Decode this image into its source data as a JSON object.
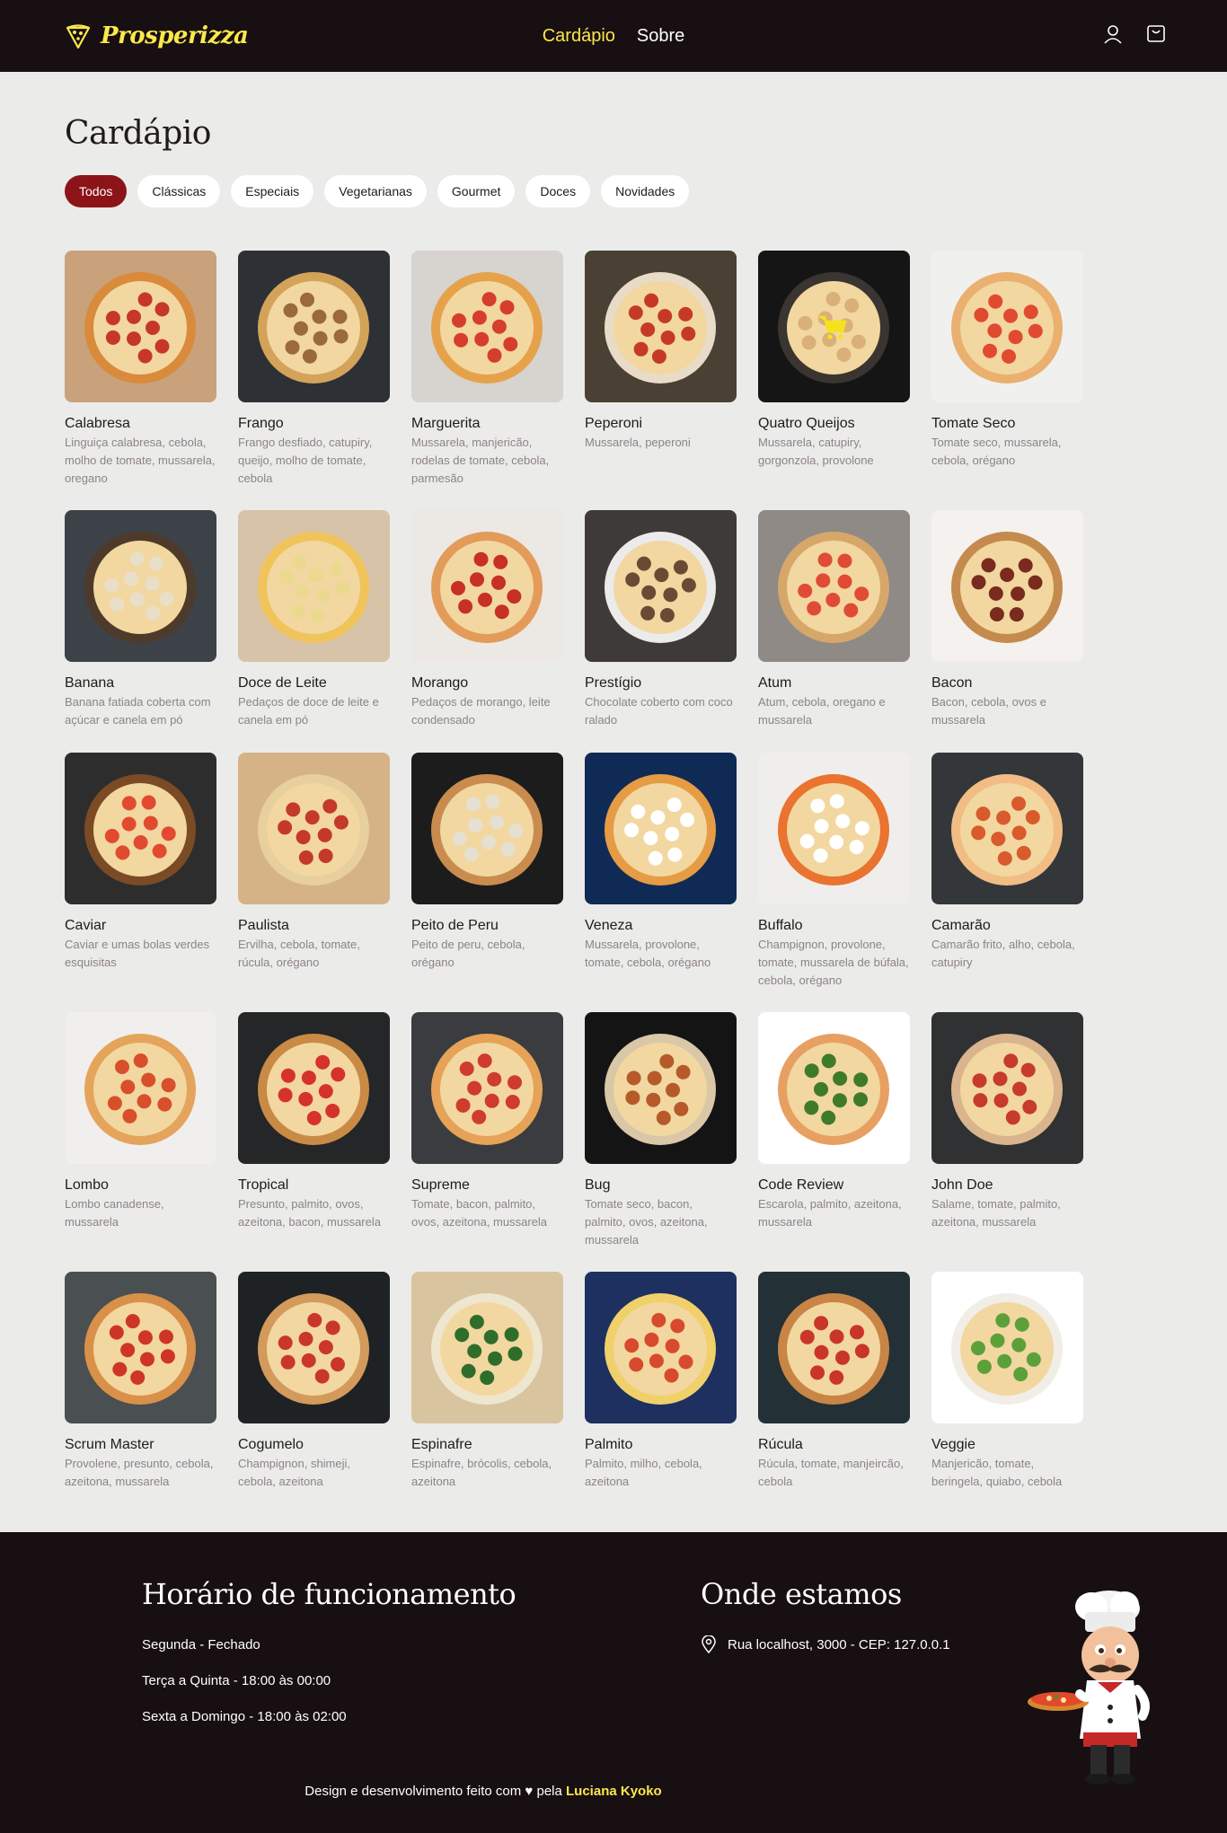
{
  "brand": {
    "name": "Prosperizza"
  },
  "nav": {
    "items": [
      {
        "label": "Cardápio"
      },
      {
        "label": "Sobre"
      }
    ]
  },
  "main": {
    "title": "Cardápio",
    "filters": [
      "Todos",
      "Clássicas",
      "Especiais",
      "Vegetarianas",
      "Gourmet",
      "Doces",
      "Novidades"
    ],
    "selected_filter": "Todos"
  },
  "pizzas": [
    {
      "name": "Calabresa",
      "desc": "Linguiça calabresa, cebola, molho de tomate, mussarela, oregano"
    },
    {
      "name": "Frango",
      "desc": "Frango desfiado, catupiry, queijo, molho de tomate, cebola"
    },
    {
      "name": "Marguerita",
      "desc": "Mussarela, manjericão, rodelas de tomate, cebola, parmesão"
    },
    {
      "name": "Peperoni",
      "desc": "Mussarela, peperoni"
    },
    {
      "name": "Quatro Queijos",
      "desc": "Mussarela, catupiry, gorgonzola, provolone"
    },
    {
      "name": "Tomate Seco",
      "desc": "Tomate seco, mussarela, cebola, orégano"
    },
    {
      "name": "Banana",
      "desc": "Banana fatiada coberta com açúcar e canela em pó"
    },
    {
      "name": "Doce de Leite",
      "desc": "Pedaços de doce de leite e canela em pó"
    },
    {
      "name": "Morango",
      "desc": "Pedaços de morango, leite condensado"
    },
    {
      "name": "Prestígio",
      "desc": "Chocolate coberto com coco ralado"
    },
    {
      "name": "Atum",
      "desc": "Atum, cebola, oregano e mussarela"
    },
    {
      "name": "Bacon",
      "desc": "Bacon, cebola, ovos e mussarela"
    },
    {
      "name": "Caviar",
      "desc": "Caviar e umas bolas verdes esquisitas"
    },
    {
      "name": "Paulista",
      "desc": "Ervilha, cebola, tomate, rúcula, orégano"
    },
    {
      "name": "Peito de Peru",
      "desc": "Peito de peru, cebola, orégano"
    },
    {
      "name": "Veneza",
      "desc": "Mussarela, provolone, tomate, cebola, orégano"
    },
    {
      "name": "Buffalo",
      "desc": "Champignon, provolone, tomate, mussarela de búfala, cebola, orégano"
    },
    {
      "name": "Camarão",
      "desc": "Camarão frito, alho, cebola, catupiry"
    },
    {
      "name": "Lombo",
      "desc": "Lombo canadense, mussarela"
    },
    {
      "name": "Tropical",
      "desc": "Presunto, palmito, ovos, azeitona, bacon, mussarela"
    },
    {
      "name": "Supreme",
      "desc": "Tomate, bacon, palmito, ovos, azeitona, mussarela"
    },
    {
      "name": "Bug",
      "desc": "Tomate seco, bacon, palmito, ovos, azeitona, mussarela"
    },
    {
      "name": "Code Review",
      "desc": "Escarola, palmito, azeitona, mussarela"
    },
    {
      "name": "John Doe",
      "desc": "Salame, tomate, palmito, azeitona, mussarela"
    },
    {
      "name": "Scrum Master",
      "desc": "Provolene, presunto, cebola, azeitona, mussarela"
    },
    {
      "name": "Cogumelo",
      "desc": "Champignon, shimeji, cebola, azeitona"
    },
    {
      "name": "Espinafre",
      "desc": "Espinafre, brócolis, cebola, azeitona"
    },
    {
      "name": "Palmito",
      "desc": "Palmito, milho, cebola, azeitona"
    },
    {
      "name": "Rúcula",
      "desc": "Rúcula, tomate, manjeircão, cebola"
    },
    {
      "name": "Veggie",
      "desc": "Manjericão, tomate, beringela, quiabo, cebola"
    }
  ],
  "footer": {
    "hours": {
      "title": "Horário de funcionamento",
      "lines": [
        "Segunda - Fechado",
        "Terça a Quinta - 18:00 às 00:00",
        "Sexta a Domingo - 18:00 às 02:00"
      ]
    },
    "location": {
      "title": "Onde estamos",
      "address": "Rua localhost, 3000 - CEP: 127.0.0.1"
    },
    "credits": {
      "prefix": "Design e desenvolvimento feito com",
      "heart": "♥",
      "by": "pela",
      "author": "Luciana Kyoko"
    }
  },
  "colors": {
    "accent": "#fbe84a",
    "header_bg": "#170f11",
    "active_chip": "#8c1418",
    "page_bg": "#ebebea"
  }
}
